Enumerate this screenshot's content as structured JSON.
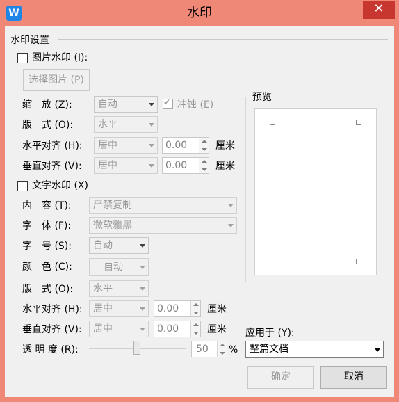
{
  "window": {
    "title": "水印",
    "close_glyph": "✕",
    "app_icon_glyph": "W"
  },
  "group": {
    "title": "水印设置"
  },
  "picture": {
    "checkbox_label": "图片水印 (I):",
    "checked": false,
    "select_button": "选择图片 (P)",
    "scale_label": "缩　放 (Z):",
    "scale_value": "自动",
    "erode_label": "冲蚀 (E)",
    "erode_checked": true,
    "layout_label": "版　式 (O):",
    "layout_value": "水平",
    "halign_label": "水平对齐 (H):",
    "halign_value": "居中",
    "halign_offset": "0.00",
    "valign_label": "垂直对齐 (V):",
    "valign_value": "居中",
    "valign_offset": "0.00",
    "unit": "厘米"
  },
  "text": {
    "checkbox_label": "文字水印 (X)",
    "checked": false,
    "content_label": "内　容 (T):",
    "content_value": "严禁复制",
    "font_label": "字　体 (F):",
    "font_value": "微软雅黑",
    "size_label": "字　号 (S):",
    "size_value": "自动",
    "color_label": "颜　色 (C):",
    "color_value": "自动",
    "layout_label": "版　式 (O):",
    "layout_value": "水平",
    "halign_label": "水平对齐 (H):",
    "halign_value": "居中",
    "halign_offset": "0.00",
    "valign_label": "垂直对齐 (V):",
    "valign_value": "居中",
    "valign_offset": "0.00",
    "unit": "厘米",
    "opacity_label": "透 明 度 (R):",
    "opacity_value": "50",
    "opacity_unit": "%"
  },
  "preview": {
    "label": "预览"
  },
  "apply": {
    "label": "应用于 (Y):",
    "value": "整篇文档"
  },
  "buttons": {
    "ok": "确定",
    "cancel": "取消"
  },
  "colors": {
    "frame": "#f08878",
    "close_button": "#c7372f",
    "app_icon": "#1f85e6",
    "dialog_bg": "#f0f0f0"
  }
}
